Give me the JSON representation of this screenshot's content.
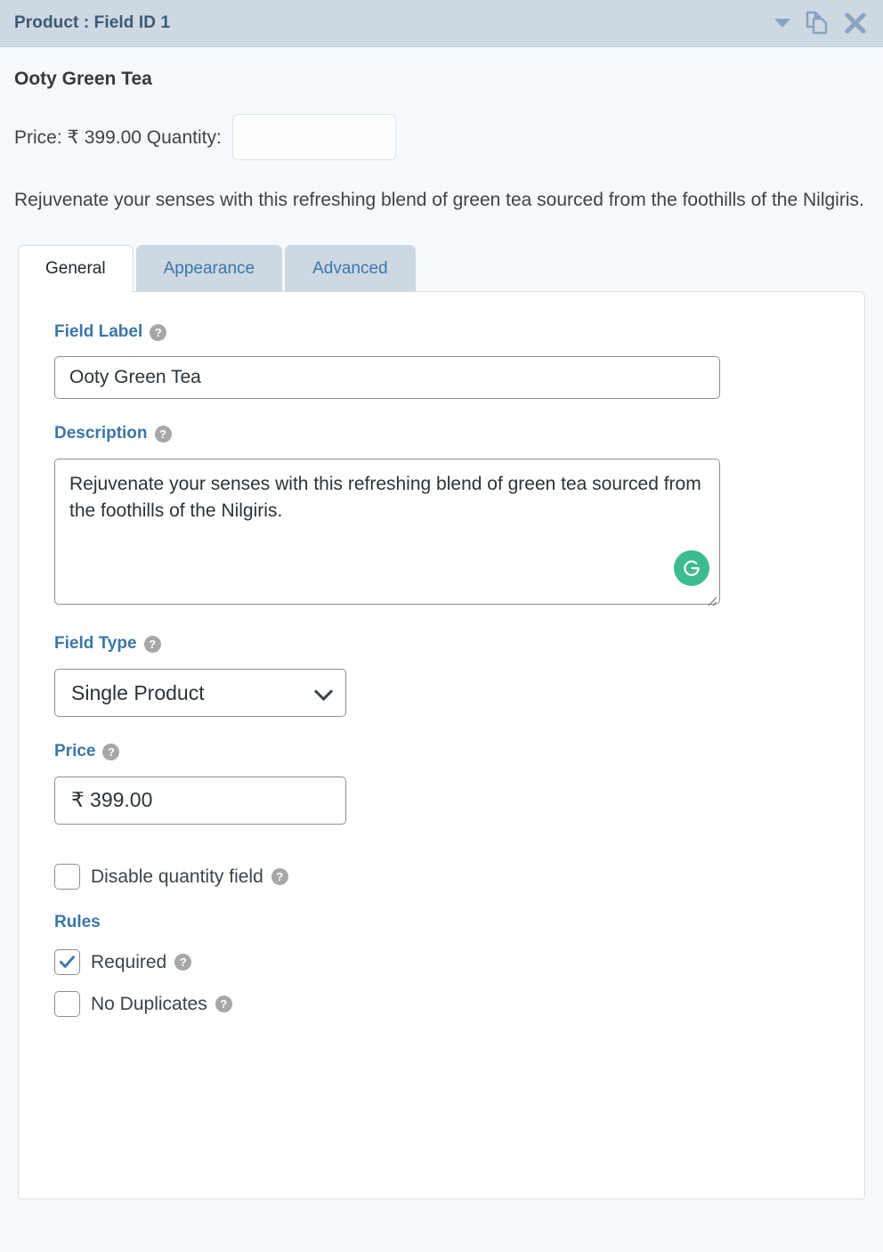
{
  "titlebar": {
    "title": "Product : Field ID 1",
    "icons": {
      "collapse": "chevron-down-icon",
      "duplicate": "duplicate-icon",
      "close": "close-icon"
    }
  },
  "preview": {
    "product_name": "Ooty Green Tea",
    "price_label": "Price: ₹ 399.00 Quantity:",
    "quantity_value": "",
    "quantity_placeholder": "",
    "description": "Rejuvenate your senses with this refreshing blend of green tea sourced from the foothills of the Nilgiris."
  },
  "tabs": [
    {
      "label": "General",
      "active": true
    },
    {
      "label": "Appearance",
      "active": false
    },
    {
      "label": "Advanced",
      "active": false
    }
  ],
  "general": {
    "field_label": {
      "label": "Field Label",
      "help": "?",
      "value": "Ooty Green Tea"
    },
    "description": {
      "label": "Description",
      "help": "?",
      "value": "Rejuvenate your senses with this refreshing blend of green tea sourced from the foothills of the Nilgiris.",
      "badge": "grammarly-icon"
    },
    "field_type": {
      "label": "Field Type",
      "help": "?",
      "selected": "Single Product",
      "options": [
        "Single Product"
      ]
    },
    "price": {
      "label": "Price",
      "help": "?",
      "value": "₹ 399.00"
    },
    "disable_quantity": {
      "label": "Disable quantity field",
      "help": "?",
      "checked": false
    },
    "rules_heading": "Rules",
    "rules": [
      {
        "label": "Required",
        "help": "?",
        "checked": true
      },
      {
        "label": "No Duplicates",
        "help": "?",
        "checked": false
      }
    ]
  },
  "colors": {
    "titlebar_bg": "#cdd8e3",
    "titlebar_text": "#3c5a72",
    "accent_blue": "#3b76a8",
    "page_bg": "#f7fafc",
    "panel_bg": "#ffffff",
    "checkbox_check": "#3a7cb8",
    "grammarly_green": "#3cbb8e",
    "help_gray": "#a7a7a7"
  }
}
